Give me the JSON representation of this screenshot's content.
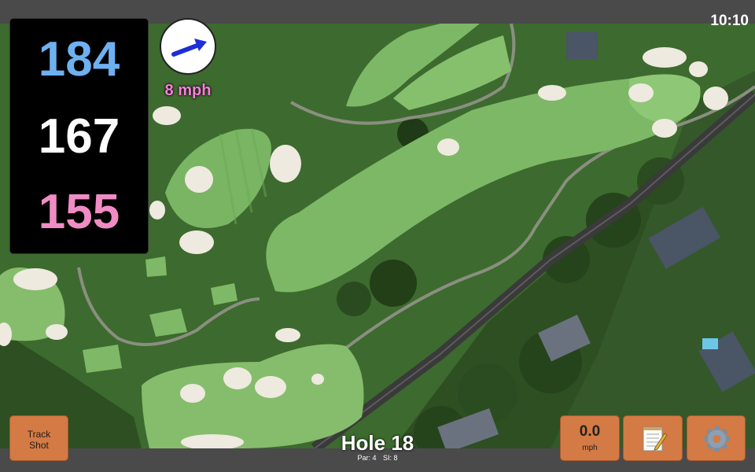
{
  "status_bar": {
    "time": "10:10"
  },
  "distances": {
    "back": "184",
    "middle": "167",
    "front": "155",
    "colors": {
      "back": "#6fb0f0",
      "middle": "#ffffff",
      "front": "#f08cc4"
    }
  },
  "wind": {
    "speed_text": "8 mph",
    "speed_color": "#ff7de0",
    "arrow_icon": "wind-direction-arrow-icon",
    "arrow_color": "#1a2fd8"
  },
  "buttons": {
    "track_shot_line1": "Track",
    "track_shot_line2": "Shot",
    "speed_value": "0.0",
    "speed_unit": "mph",
    "notes_icon": "notepad-icon",
    "settings_icon": "gear-icon"
  },
  "hole": {
    "title": "Hole 18",
    "par": "Par: 4",
    "si": "SI: 8"
  },
  "theme": {
    "button_color": "#d47a44",
    "bar_color": "#4a4a4a"
  }
}
